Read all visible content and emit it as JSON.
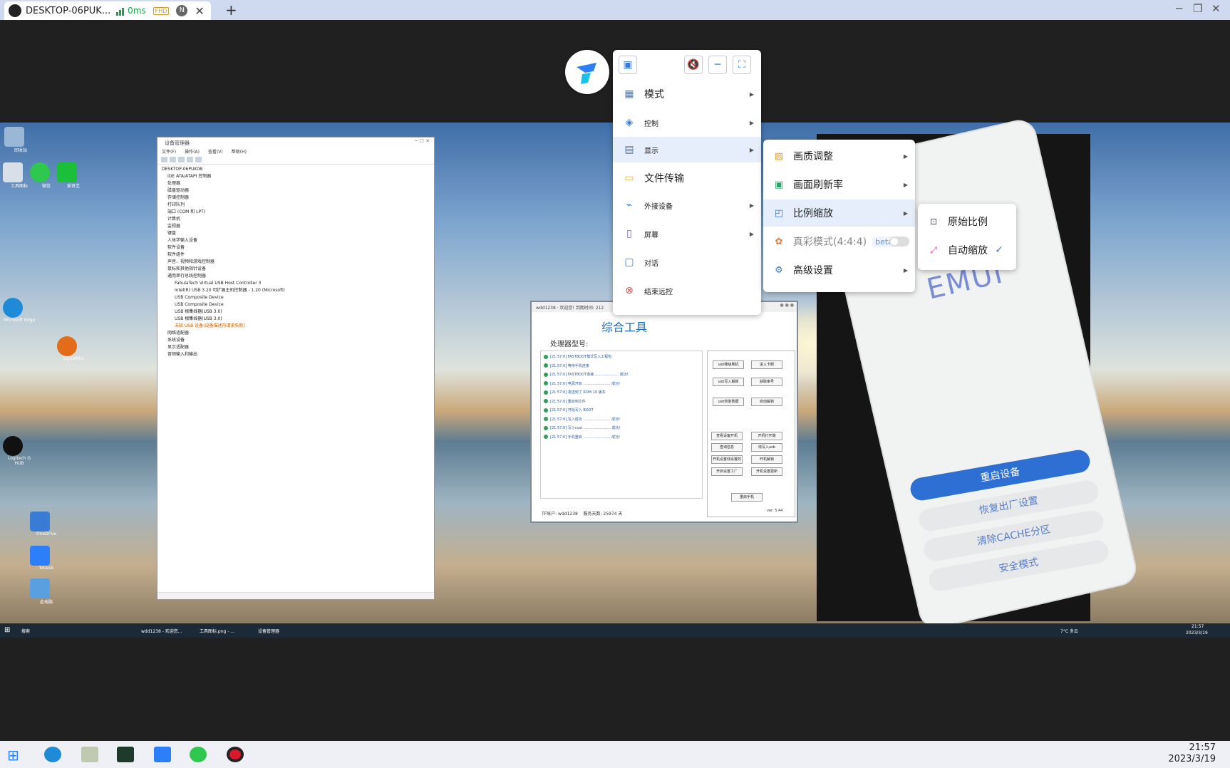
{
  "tab": {
    "title": "DESKTOP-06PUK...",
    "latency": "0ms",
    "quality_badge": "FHD",
    "account_badge": "N"
  },
  "remote": {
    "desktop_icons": [
      "回收站",
      "工具图标",
      "微信",
      "爱奇艺",
      "Microsoft Edge",
      "SignalRky",
      "OneDrive",
      "ToDesk",
      "Logitech G HUB",
      "此电脑"
    ],
    "device_manager": {
      "title": "设备管理器",
      "menu": [
        "文件(F)",
        "操作(A)",
        "查看(V)",
        "帮助(H)"
      ],
      "tree": [
        "DESKTOP-06PUK0B",
        "IDE ATA/ATAPI 控制器",
        "处理器",
        "磁盘驱动器",
        "存储控制器",
        "打印队列",
        "端口 (COM 和 LPT)",
        "计算机",
        "监视器",
        "键盘",
        "人体学输入设备",
        "软件设备",
        "软件组件",
        "声音、视频和游戏控制器",
        "鼠标和其他指针设备",
        "通用串行总线控制器",
        "FabulaTech Virtual USB Host Controller 3",
        "Intel(R) USB 3.20 可扩展主机控制器 - 1.20 (Microsoft)",
        "USB Composite Device",
        "USB Composite Device",
        "USB 根集线器(USB 3.0)",
        "USB 根集线器(USB 3.0)",
        "未知 USB 设备(设备描述符请求失败)",
        "网络适配器",
        "系统设备",
        "显示适配器",
        "音频输入和输出"
      ]
    },
    "tool": {
      "header": "wdd1238 · 欢迎您!   到期时间: 212",
      "title": "综合工具",
      "processor_label": "处理器型号:",
      "log": [
        "[21:57:0] FASTBOOT模式写入工程包",
        "[21:57:0]        等待手机连接",
        "[21:57:0] FASTBOOT连接 ..................... 成功!",
        "[21:57:0] 电源开启 ........................ 成功!",
        "[21:57:0] 发送到了 ROM 10 版本",
        "[21:57:0] 重启到文件",
        "[21:57:0] 开始写入 BOOT",
        "[21:57:0] 写入成功 ........................ 成功!",
        "[21:57:0] 写入cust ........................ 成功!",
        "[21:57:0] 手机重启 ........................ 成功!"
      ],
      "buttons": [
        "usb降级刷机",
        "进入卡刷",
        "usb写入解锁",
        "获取串号",
        "usb恢复数据",
        "启动解锁",
        "查看设备开机",
        "开机打开端",
        "查询信息",
        "线写入usb",
        "开机设置线设置的",
        "开机解锁",
        "开启设置工厂",
        "开机设置更新",
        "重启手机"
      ],
      "footer_user": "TF账户: wdd1238",
      "footer_days": "服务天数: 25974 天",
      "version": "ver: 5.44"
    },
    "phone": {
      "brand": "EMUI",
      "menu": [
        "重启设备",
        "恢复出厂设置",
        "清除CACHE分区",
        "安全模式"
      ]
    },
    "windows_taskbar": {
      "search": "搜索",
      "apps": [
        "wdd1238 - 欢迎您...",
        "工具图标.png - ...",
        "设备管理器"
      ],
      "weather": "7°C 多云",
      "time": "21:57",
      "date": "2023/3/19"
    }
  },
  "toolbar": {
    "display_icon": "monitor-check-icon",
    "mute_icon": "speaker-muted-icon",
    "minimize_icon": "minus-icon",
    "fullscreen_icon": "fullscreen-icon"
  },
  "main_menu": [
    {
      "label": "模式",
      "icon": "grid-icon"
    },
    {
      "label": "控制",
      "icon": "layers-icon"
    },
    {
      "label": "显示",
      "icon": "display-icon"
    },
    {
      "label": "文件传输",
      "icon": "folder-icon"
    },
    {
      "label": "外接设备",
      "icon": "usb-icon"
    },
    {
      "label": "屏幕",
      "icon": "screens-icon"
    },
    {
      "label": "对话",
      "icon": "chat-icon"
    },
    {
      "label": "结束远控",
      "icon": "close-circle-icon"
    }
  ],
  "display_submenu": [
    {
      "label": "画质调整",
      "icon": "image-quality-icon"
    },
    {
      "label": "画面刷新率",
      "icon": "refresh-rate-icon"
    },
    {
      "label": "比例缩放",
      "icon": "scale-icon"
    },
    {
      "label": "真彩模式(4:4:4)",
      "icon": "color-wheel-icon",
      "badge": "beta"
    },
    {
      "label": "高级设置",
      "icon": "gear-icon"
    }
  ],
  "scale_submenu": [
    {
      "label": "原始比例",
      "icon": "one-to-one-icon",
      "checked": false
    },
    {
      "label": "自动缩放",
      "icon": "auto-scale-icon",
      "checked": true
    }
  ],
  "bottom_taskbar": {
    "time": "21:57",
    "date": "2023/3/19"
  },
  "colors": {
    "accent": "#3a7bd5",
    "titlebar": "#cfd9ef"
  }
}
